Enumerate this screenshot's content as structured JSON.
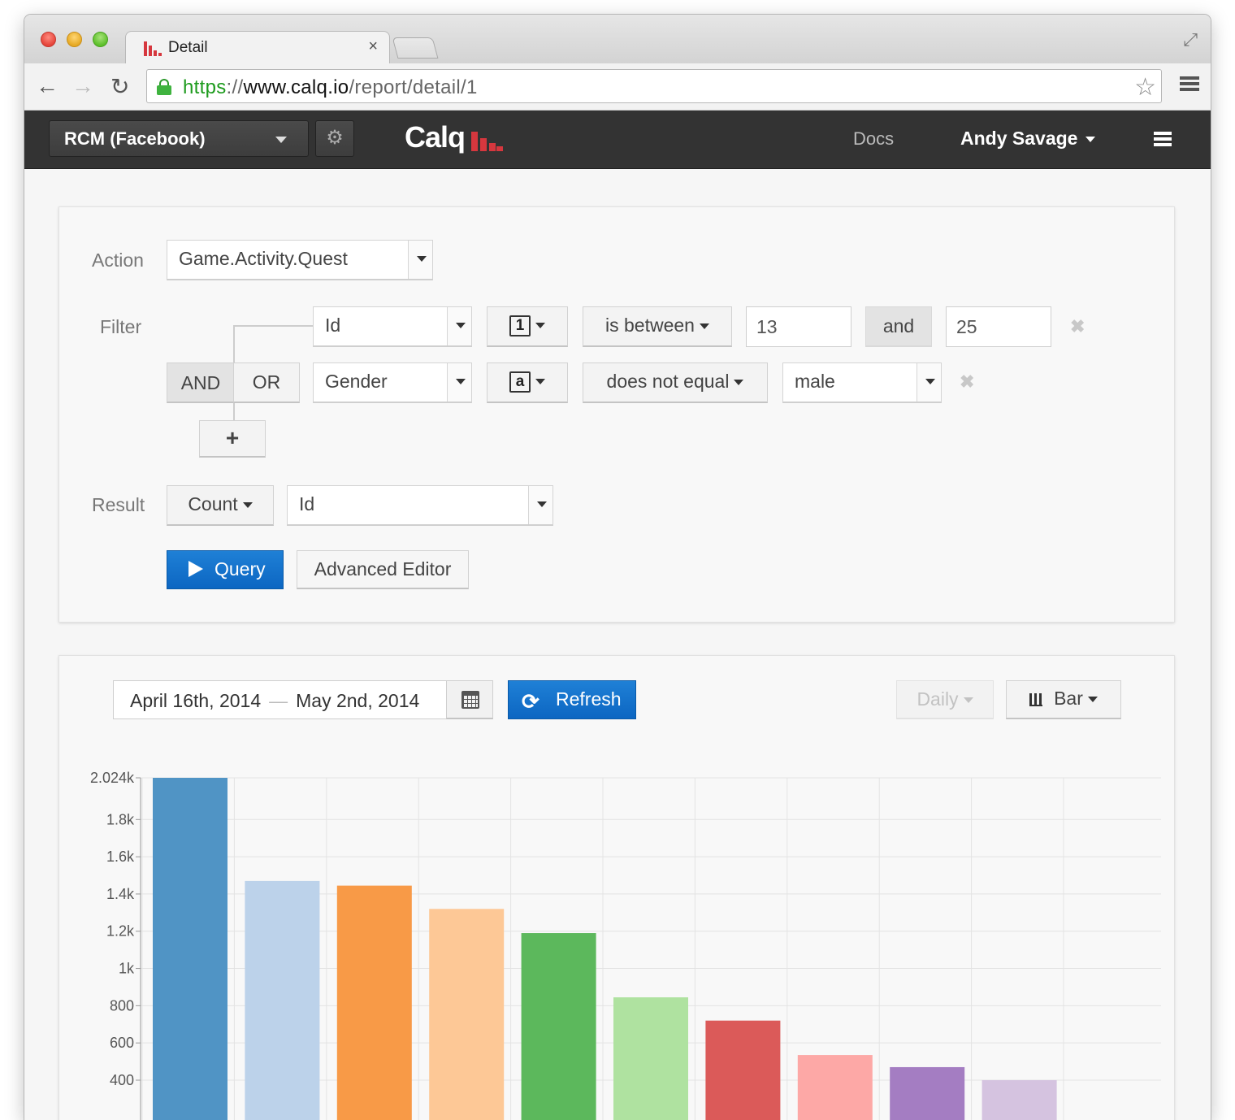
{
  "browser": {
    "tab_title": "Detail",
    "tab_close": "×",
    "url": {
      "scheme": "https",
      "sep": "://",
      "host": "www.calq.io",
      "path": "/report/detail/1"
    }
  },
  "navbar": {
    "project": "RCM (Facebook)",
    "brand": "Calq",
    "docs": "Docs",
    "user": "Andy Savage"
  },
  "query": {
    "action_label": "Action",
    "action_value": "Game.Activity.Quest",
    "filter_label": "Filter",
    "logic_and": "AND",
    "logic_or": "OR",
    "add_symbol": "+",
    "filters": [
      {
        "property": "Id",
        "type": "1",
        "operator": "is between",
        "value": "13",
        "joiner": "and",
        "value2": "25"
      },
      {
        "property": "Gender",
        "type": "a",
        "operator": "does not equal",
        "value": "male"
      }
    ],
    "remove_symbol": "✖",
    "result_label": "Result",
    "result_agg": "Count",
    "result_property": "Id",
    "query_button": "Query",
    "advanced_button": "Advanced Editor"
  },
  "chart_controls": {
    "date_start": "April 16th, 2014",
    "date_sep": "—",
    "date_end": "May 2nd, 2014",
    "refresh_button": "Refresh",
    "interval": "Daily",
    "chart_type": "Bar"
  },
  "chart_data": {
    "type": "bar",
    "y_ticks": [
      "2.024k",
      "1.8k",
      "1.6k",
      "1.4k",
      "1.2k",
      "1k",
      "800",
      "600",
      "400"
    ],
    "y_tick_values": [
      2024,
      1800,
      1600,
      1400,
      1200,
      1000,
      800,
      600,
      400
    ],
    "ylim": [
      400,
      2024
    ],
    "values": [
      2024,
      1470,
      1445,
      1320,
      1190,
      845,
      720,
      535,
      470,
      400
    ],
    "colors": [
      "#5094c5",
      "#bcd2ea",
      "#f89a47",
      "#fdc896",
      "#5cb85c",
      "#afe2a0",
      "#db5a59",
      "#fda8a6",
      "#a47dc2",
      "#d5c3e0"
    ],
    "grid": true
  }
}
